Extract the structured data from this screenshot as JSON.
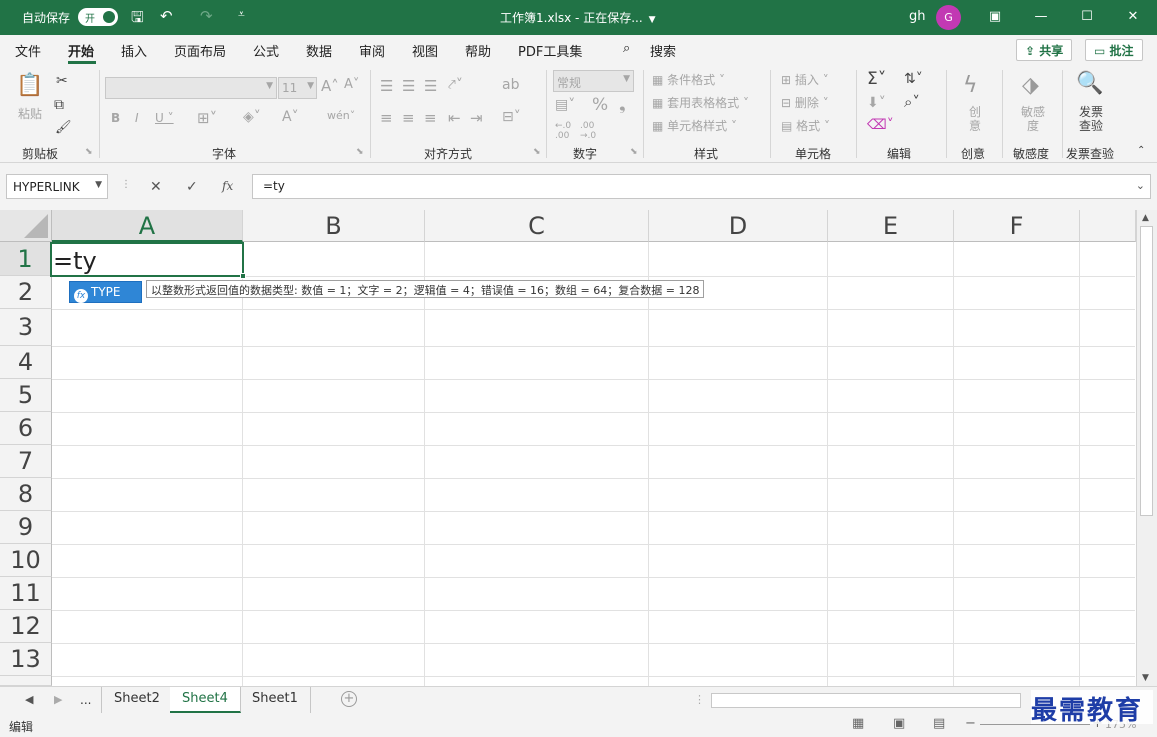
{
  "titlebar": {
    "autosave_label": "自动保存",
    "autosave_toggle": "开",
    "doc_title": "工作簿1.xlsx - 正在保存...",
    "user_name": "gh",
    "avatar_initial": "G"
  },
  "menu": {
    "tabs": [
      "文件",
      "开始",
      "插入",
      "页面布局",
      "公式",
      "数据",
      "审阅",
      "视图",
      "帮助",
      "PDF工具集"
    ],
    "search_label": "搜索",
    "share_label": "共享",
    "comment_label": "批注"
  },
  "ribbon": {
    "groups": [
      "剪贴板",
      "字体",
      "对齐方式",
      "数字",
      "样式",
      "单元格",
      "编辑",
      "创意",
      "敏感度",
      "发票查验"
    ],
    "paste_label": "粘贴",
    "font_size": "11",
    "number_format": "常规",
    "conditional_format": "条件格式",
    "table_format": "套用表格格式",
    "cell_styles": "单元格样式",
    "insert": "插入",
    "delete": "删除",
    "format": "格式",
    "creative_label": "创意",
    "sensitivity_label": "敏感度",
    "invoice_label": "发票查验"
  },
  "formula_bar": {
    "name_box": "HYPERLINK",
    "formula": "=ty"
  },
  "grid": {
    "columns": [
      "A",
      "B",
      "C",
      "D",
      "E",
      "F"
    ],
    "rows": [
      "1",
      "2",
      "3",
      "4",
      "5",
      "6",
      "7",
      "8",
      "9",
      "10",
      "11",
      "12",
      "13"
    ],
    "active_cell_value": "=ty",
    "autocomplete_item": "TYPE",
    "autocomplete_tip": "以整数形式返回值的数据类型: 数值 = 1；文字 = 2；逻辑值 = 4；错误值 = 16；数组 = 64；复合数据 = 128"
  },
  "sheets": {
    "more": "...",
    "tabs": [
      "Sheet2",
      "Sheet4",
      "Sheet1"
    ],
    "active": "Sheet4"
  },
  "status": {
    "mode": "编辑",
    "zoom": "175%"
  },
  "watermark": "最需教育",
  "colors": {
    "accent": "#217346",
    "autocomplete": "#2f86d6"
  }
}
